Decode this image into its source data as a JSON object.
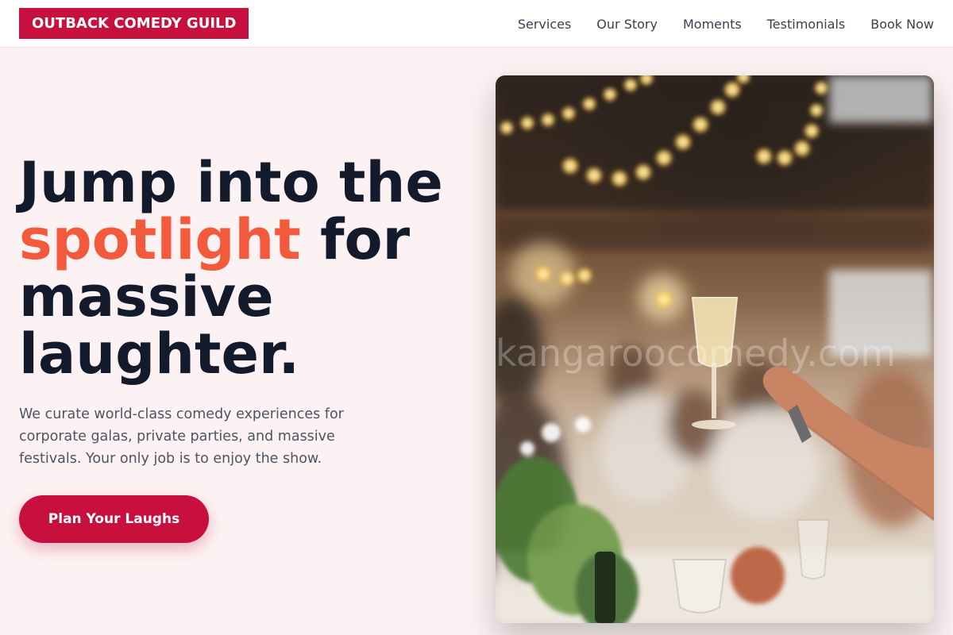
{
  "header": {
    "logo": "OUTBACK COMEDY GUILD",
    "nav": [
      "Services",
      "Our Story",
      "Moments",
      "Testimonials",
      "Book Now"
    ]
  },
  "hero": {
    "title_line1": "Jump into the",
    "title_accent": "spotlight",
    "title_line2_rest": " for",
    "title_line3": "massive",
    "title_line4": "laughter.",
    "description": "We curate world-class comedy experiences for corporate galas, private parties, and massive festivals. Your only job is to enjoy the show.",
    "cta_label": "Plan Your Laughs"
  },
  "photo": {
    "watermark": "kangaroocomedy.com"
  },
  "colors": {
    "brand": "#c8103e",
    "accent": "#f35a3b",
    "heading": "#131a2b",
    "background": "#fdf2f3"
  }
}
